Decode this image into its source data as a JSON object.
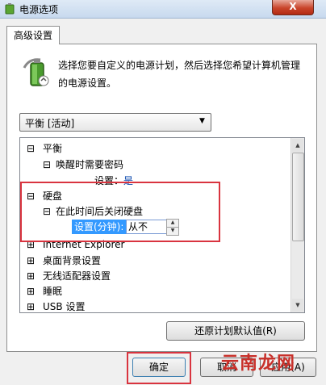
{
  "window": {
    "title": "电源选项",
    "close_label": "X"
  },
  "tab": {
    "label": "高级设置"
  },
  "description": "选择您要自定义的电源计划，然后选择您希望计算机管理的电源设置。",
  "plan_select": {
    "value": "平衡 [活动]"
  },
  "tree": {
    "n0": {
      "label": "平衡",
      "glyph": "⊟"
    },
    "n1": {
      "label": "唤醒时需要密码",
      "glyph": "⊟"
    },
    "n2": {
      "label": "设置：",
      "value": "是"
    },
    "n3": {
      "label": "硬盘",
      "glyph": "⊟"
    },
    "n4": {
      "label": "在此时间后关闭硬盘",
      "glyph": "⊟"
    },
    "n5": {
      "label": "设置(分钟):",
      "value": "从不"
    },
    "n6": {
      "label": "Internet Explorer",
      "glyph": "⊞"
    },
    "n7": {
      "label": "桌面背景设置",
      "glyph": "⊞"
    },
    "n8": {
      "label": "无线适配器设置",
      "glyph": "⊞"
    },
    "n9": {
      "label": "睡眠",
      "glyph": "⊞"
    },
    "n10": {
      "label": "USB 设置",
      "glyph": "⊞"
    }
  },
  "buttons": {
    "restore": "还原计划默认值(R)",
    "ok": "确定",
    "cancel": "取消",
    "apply": "应用(A)"
  },
  "watermark": "云南龙网",
  "colors": {
    "highlight": "#3399ff",
    "red_box": "#d9343f",
    "link_blue": "#0645ad"
  }
}
